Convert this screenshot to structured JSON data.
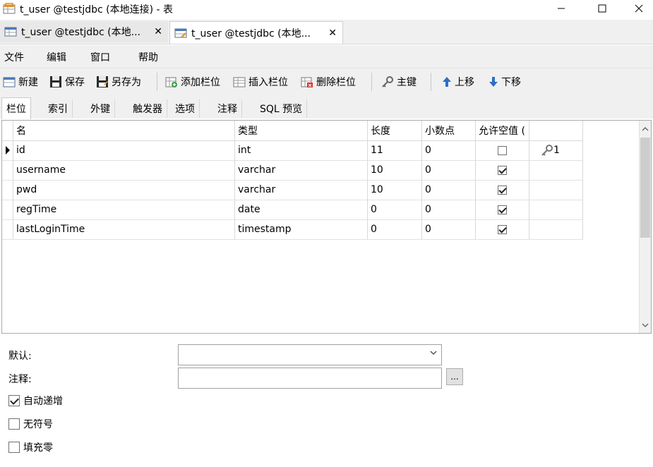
{
  "window": {
    "title": "t_user @testjdbc (本地连接) - 表"
  },
  "tabs": [
    {
      "label": "t_user @testjdbc (本地..."
    },
    {
      "label": "t_user @testjdbc (本地..."
    }
  ],
  "menu": [
    "文件",
    "编辑",
    "窗口",
    "帮助"
  ],
  "toolbar": {
    "new": "新建",
    "save": "保存",
    "save_as": "另存为",
    "add_field": "添加栏位",
    "insert_field": "插入栏位",
    "delete_field": "删除栏位",
    "primary_key": "主键",
    "move_up": "上移",
    "move_down": "下移"
  },
  "prop_tabs": [
    "栏位",
    "索引",
    "外键",
    "触发器",
    "选项",
    "注释",
    "SQL 预览"
  ],
  "grid": {
    "columns": [
      "名",
      "类型",
      "长度",
      "小数点",
      "允许空值 ("
    ],
    "rows": [
      {
        "name": "id",
        "type": "int",
        "length": "11",
        "decimals": "0",
        "nullable": false,
        "key": "1"
      },
      {
        "name": "username",
        "type": "varchar",
        "length": "10",
        "decimals": "0",
        "nullable": true,
        "key": ""
      },
      {
        "name": "pwd",
        "type": "varchar",
        "length": "10",
        "decimals": "0",
        "nullable": true,
        "key": ""
      },
      {
        "name": "regTime",
        "type": "date",
        "length": "0",
        "decimals": "0",
        "nullable": true,
        "key": ""
      },
      {
        "name": "lastLoginTime",
        "type": "timestamp",
        "length": "0",
        "decimals": "0",
        "nullable": true,
        "key": ""
      }
    ]
  },
  "form": {
    "default_label": "默认:",
    "comment_label": "注释:",
    "ellipsis": "...",
    "auto_increment": {
      "label": "自动递增",
      "checked": true
    },
    "unsigned": {
      "label": "无符号",
      "checked": false
    },
    "zerofill": {
      "label": "填充零",
      "checked": false
    }
  }
}
